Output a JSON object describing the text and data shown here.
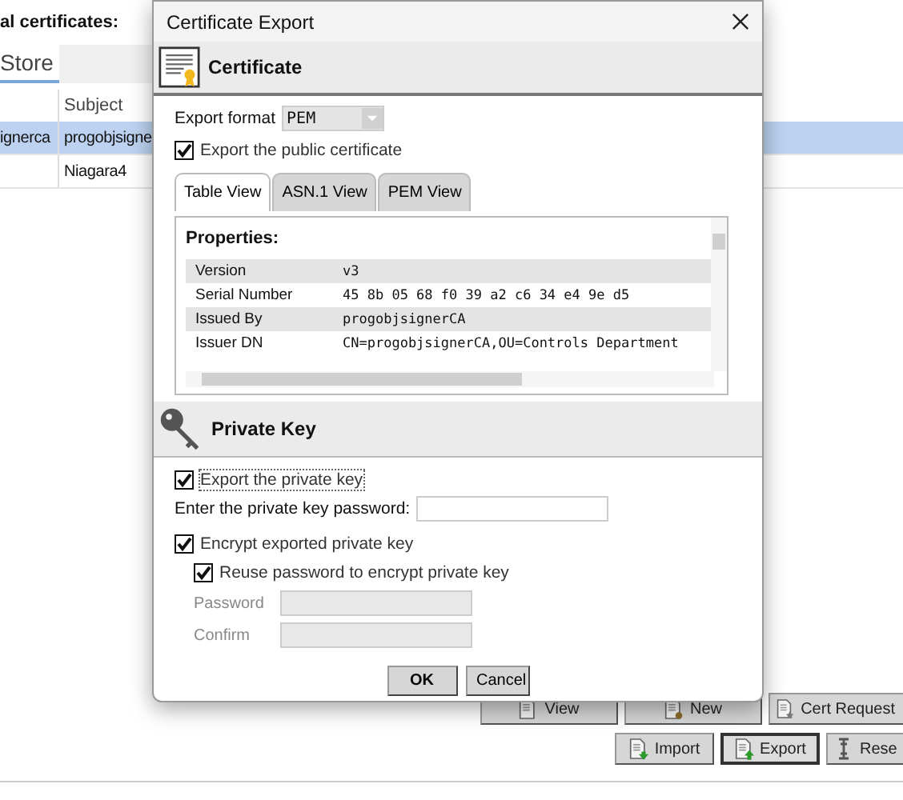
{
  "background": {
    "heading": "al certificates:",
    "tabs": [
      {
        "label": "Store",
        "selected": true
      }
    ],
    "table": {
      "subject_header": "Subject",
      "rows": [
        {
          "column_1": "ignerca",
          "subject": "progobjsigne",
          "selected": true
        },
        {
          "subject": "Niagara4",
          "selected": false
        }
      ]
    },
    "button_rows": [
      [
        {
          "label": "View",
          "kind": "doc",
          "focused": false
        },
        {
          "label": "New",
          "kind": "new",
          "focused": false
        },
        {
          "label": "Cert Request",
          "kind": "request",
          "focused": false
        }
      ],
      [
        {
          "label": "Import",
          "kind": "import",
          "focused": false
        },
        {
          "label": "Export",
          "kind": "export",
          "focused": true
        },
        {
          "label": "Rese",
          "kind": "reset",
          "focused": false
        }
      ]
    ]
  },
  "dialog": {
    "title": "Certificate Export",
    "certificate": {
      "heading": "Certificate",
      "export_format_label": "Export format",
      "export_format": "PEM",
      "export_public": {
        "label": "Export the public certificate",
        "checked": true
      },
      "tabs": [
        {
          "label": "Table View",
          "selected": true
        },
        {
          "label": "ASN.1 View",
          "selected": false
        },
        {
          "label": "PEM View",
          "selected": false
        }
      ],
      "properties_heading": "Properties:",
      "properties": [
        {
          "name": "Version",
          "value": "v3"
        },
        {
          "name": "Serial Number",
          "value": "45 8b 05 68 f0 39 a2 c6 34 e4 9e d5"
        },
        {
          "name": "Issued By",
          "value": "progobjsignerCA"
        },
        {
          "name": "Issuer DN",
          "value": "CN=progobjsignerCA,OU=Controls Department"
        }
      ]
    },
    "private_key": {
      "heading": "Private Key",
      "export_private": {
        "label": "Export the private key",
        "checked": true
      },
      "password_label": "Enter the private key password:",
      "encrypt": {
        "label": "Encrypt exported private key",
        "checked": true
      },
      "reuse": {
        "label": "Reuse password to encrypt private key",
        "checked": true
      },
      "password_fields": [
        {
          "label": "Password",
          "disabled": true
        },
        {
          "label": "Confirm",
          "disabled": true
        }
      ]
    },
    "buttons": [
      "OK",
      "Cancel"
    ]
  }
}
